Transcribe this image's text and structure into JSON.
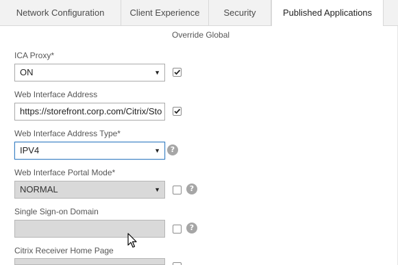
{
  "tabs": [
    {
      "label": "Network Configuration",
      "active": false
    },
    {
      "label": "Client Experience",
      "active": false
    },
    {
      "label": "Security",
      "active": false
    },
    {
      "label": "Published Applications",
      "active": true
    }
  ],
  "override_label": "Override Global",
  "fields": {
    "ica_proxy": {
      "label": "ICA Proxy*",
      "value": "ON",
      "override": true
    },
    "web_interface_address": {
      "label": "Web Interface Address",
      "value": "https://storefront.corp.com/Citrix/Sto",
      "override": true
    },
    "web_interface_address_type": {
      "label": "Web Interface Address Type*",
      "value": "IPV4"
    },
    "web_interface_portal_mode": {
      "label": "Web Interface Portal Mode*",
      "value": "NORMAL",
      "override": false
    },
    "single_sign_on_domain": {
      "label": "Single Sign-on Domain",
      "value": "",
      "override": false
    },
    "citrix_receiver_home_page": {
      "label": "Citrix Receiver Home Page",
      "value": ""
    }
  },
  "icons": {
    "dropdown": "chevron-down-icon",
    "help": "help-icon",
    "check": "checkmark-icon",
    "cursor": "mouse-cursor-icon"
  },
  "glyphs": {
    "arrow": "▼",
    "help": "?"
  },
  "colors": {
    "tab_bar": "#f2f2f2",
    "focus_border": "#3d82c4",
    "disabled_field": "#d9d9d9",
    "help_icon": "#a6a6a6"
  }
}
